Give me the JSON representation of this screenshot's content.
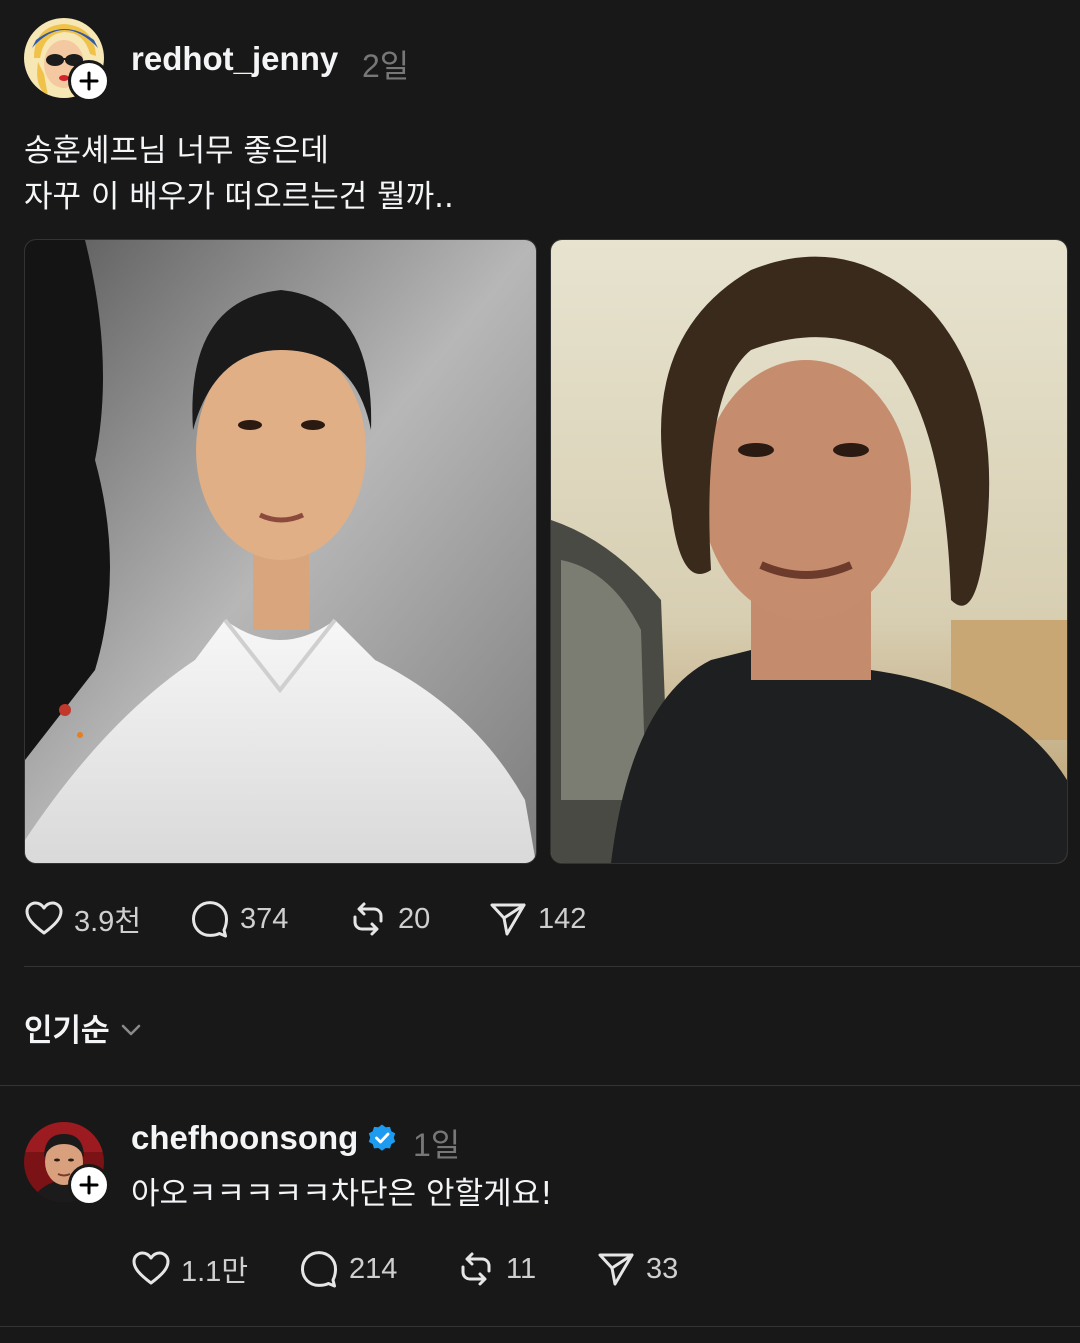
{
  "post": {
    "username": "redhot_jenny",
    "time": "2일",
    "text_lines": [
      "송훈셰프님 너무 좋은데",
      "자꾸 이 배우가 떠오르는건 뭘까.."
    ],
    "stats": {
      "likes": "3.9천",
      "comments": "374",
      "reposts": "20",
      "shares": "142"
    }
  },
  "sort": {
    "label": "인기순"
  },
  "reply": {
    "username": "chefhoonsong",
    "verified": true,
    "time": "1일",
    "text": "아오ㅋㅋㅋㅋㅋ차단은 안할게요!",
    "stats": {
      "likes": "1.1만",
      "comments": "214",
      "reposts": "11",
      "shares": "33"
    }
  },
  "colors": {
    "background": "#181818",
    "text": "#f3f5f7",
    "muted": "#777777",
    "verified": "#1d9bf0"
  }
}
